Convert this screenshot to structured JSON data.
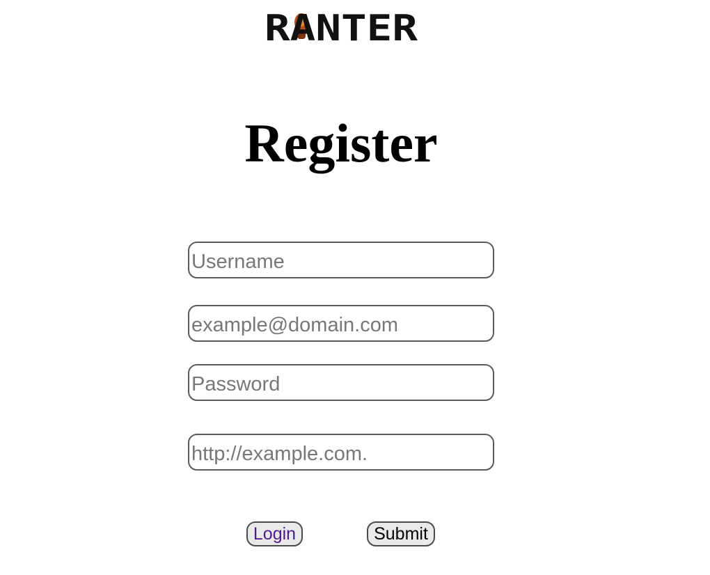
{
  "header": {
    "logo_text": "RANTER",
    "logo_alt": "Ranter logo"
  },
  "main": {
    "title": "Register"
  },
  "form": {
    "username_placeholder": "Username",
    "email_placeholder": "example@domain.com",
    "password_placeholder": "Password",
    "url_placeholder": "http://example.com."
  },
  "actions": {
    "login_label": "Login",
    "submit_label": "Submit"
  },
  "colors": {
    "login_link": "#4b1b8f",
    "logo_mascot": "#b4501e"
  }
}
